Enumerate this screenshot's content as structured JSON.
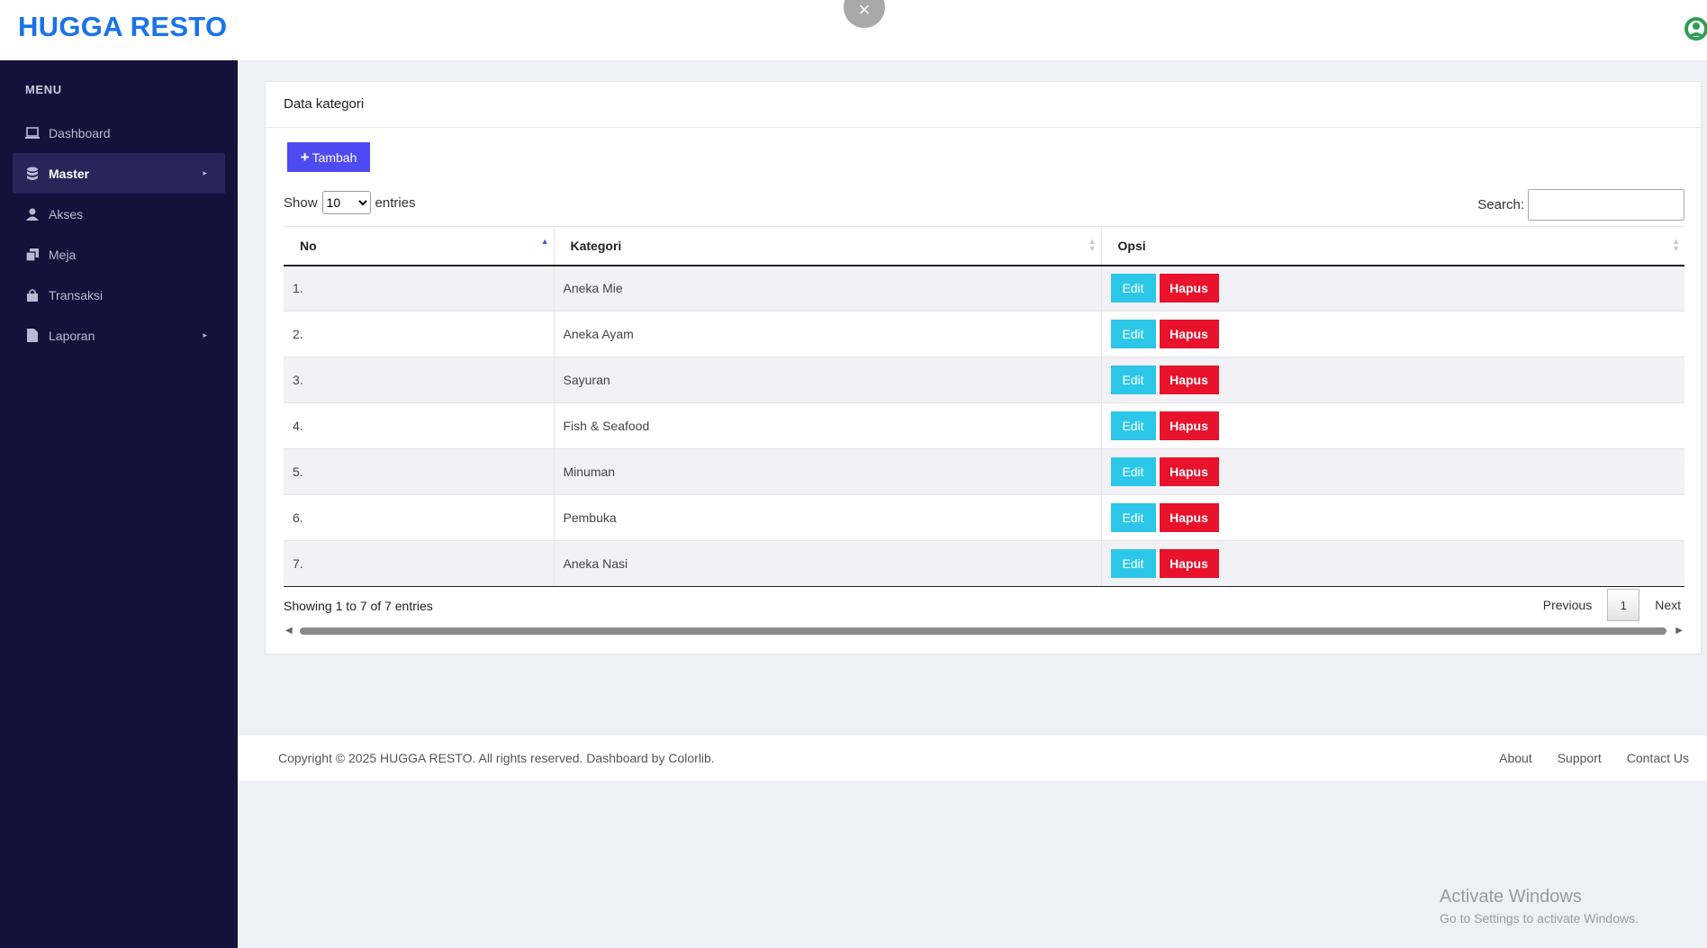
{
  "brand": "HUGGA RESTO",
  "close_icon": "×",
  "sidebar": {
    "title": "MENU",
    "items": [
      {
        "label": "Dashboard",
        "icon": "laptop-icon"
      },
      {
        "label": "Master",
        "icon": "database-icon",
        "active": true,
        "caret": true
      },
      {
        "label": "Akses",
        "icon": "user-icon"
      },
      {
        "label": "Meja",
        "icon": "stack-icon"
      },
      {
        "label": "Transaksi",
        "icon": "bag-icon"
      },
      {
        "label": "Laporan",
        "icon": "file-icon",
        "caret": true
      }
    ]
  },
  "card": {
    "title": "Data kategori",
    "add_button": "Tambah",
    "show_label": "Show",
    "entries_label": "entries",
    "page_length": "10",
    "search_label": "Search:",
    "search_value": "",
    "columns": [
      "No",
      "Kategori",
      "Opsi"
    ],
    "rows": [
      {
        "no": "1.",
        "kategori": "Aneka Mie"
      },
      {
        "no": "2.",
        "kategori": "Aneka Ayam"
      },
      {
        "no": "3.",
        "kategori": "Sayuran"
      },
      {
        "no": "4.",
        "kategori": "Fish & Seafood"
      },
      {
        "no": "5.",
        "kategori": "Minuman"
      },
      {
        "no": "6.",
        "kategori": "Pembuka"
      },
      {
        "no": "7.",
        "kategori": "Aneka Nasi"
      }
    ],
    "edit_label": "Edit",
    "delete_label": "Hapus",
    "info": "Showing 1 to 7 of 7 entries",
    "pagination": {
      "previous": "Previous",
      "current": "1",
      "next": "Next"
    }
  },
  "footer": {
    "copyright": "Copyright © 2025 HUGGA RESTO. All rights reserved. Dashboard by Colorlib.",
    "links": [
      "About",
      "Support",
      "Contact Us"
    ]
  },
  "watermark": {
    "line1": "Activate Windows",
    "line2": "Go to Settings to activate Windows."
  },
  "colors": {
    "brand": "#1a73e8",
    "sidebar_bg": "#14113a",
    "add_button": "#4f4bf2",
    "edit_button": "#2cc7e8",
    "delete_button": "#e8122c"
  }
}
